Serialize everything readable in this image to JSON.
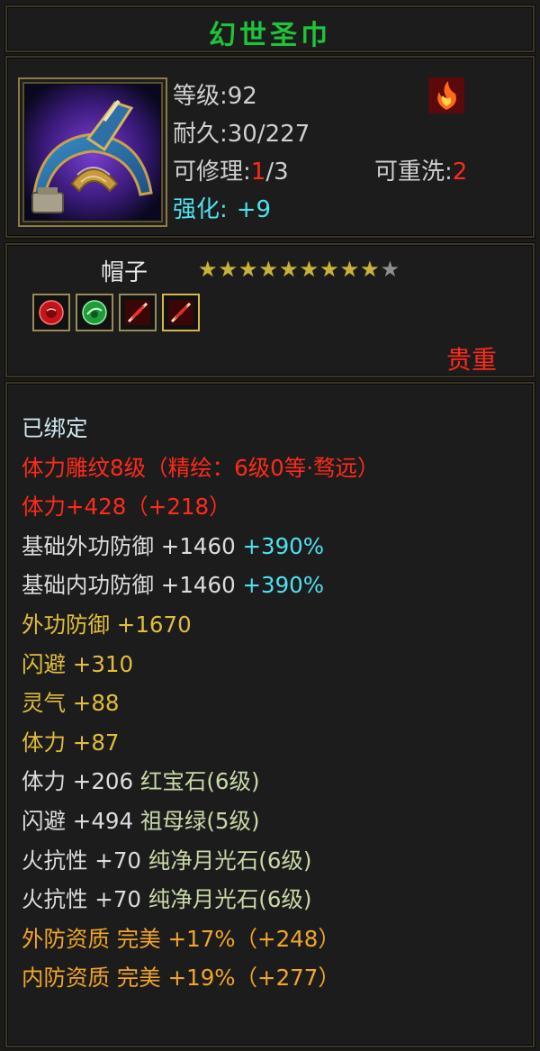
{
  "item": {
    "name": "幻世圣巾",
    "level": "等级:92",
    "durability": "耐久:30/227",
    "repair_label": "可修理:",
    "repair_value": "1",
    "repair_max": "/3",
    "reroll_label": "可重洗:",
    "reroll_value": "2",
    "enhance_label": "强化:",
    "enhance_value": "+9",
    "type": "帽子",
    "stars_total": 10,
    "stars_filled": 9,
    "rarity": "贵重",
    "gem_slots": [
      "red-gem-icon",
      "green-gem-icon",
      "red-fire-gem-icon",
      "gold-fire-gem-icon"
    ]
  },
  "stats": [
    {
      "parts": [
        {
          "t": "已绑定",
          "c": "c-bound"
        }
      ]
    },
    {
      "parts": [
        {
          "t": "体力雕纹8级（精绘：6级0等·骛远）",
          "c": "c-red"
        }
      ]
    },
    {
      "parts": [
        {
          "t": "体力+428（+218）",
          "c": "c-red"
        }
      ]
    },
    {
      "parts": [
        {
          "t": "基础外功防御 +1460 ",
          "c": "c-white"
        },
        {
          "t": "+390%",
          "c": "c-cyan"
        }
      ]
    },
    {
      "parts": [
        {
          "t": "基础内功防御 +1460 ",
          "c": "c-white"
        },
        {
          "t": "+390%",
          "c": "c-cyan"
        }
      ]
    },
    {
      "parts": [
        {
          "t": "外功防御 +1670",
          "c": "c-yellow"
        }
      ]
    },
    {
      "parts": [
        {
          "t": "闪避 +310",
          "c": "c-yellow"
        }
      ]
    },
    {
      "parts": [
        {
          "t": "灵气 +88",
          "c": "c-yellow"
        }
      ]
    },
    {
      "parts": [
        {
          "t": "体力 +87",
          "c": "c-yellow"
        }
      ]
    },
    {
      "parts": [
        {
          "t": "体力 +206 ",
          "c": "c-white"
        },
        {
          "t": "红宝石(6级)",
          "c": "c-green"
        }
      ]
    },
    {
      "parts": [
        {
          "t": "闪避 +494 ",
          "c": "c-white"
        },
        {
          "t": "祖母绿(5级)",
          "c": "c-green"
        }
      ]
    },
    {
      "parts": [
        {
          "t": "火抗性 +70 ",
          "c": "c-white"
        },
        {
          "t": "纯净月光石(6级)",
          "c": "c-green"
        }
      ]
    },
    {
      "parts": [
        {
          "t": "火抗性 +70 ",
          "c": "c-white"
        },
        {
          "t": "纯净月光石(6级)",
          "c": "c-green"
        }
      ]
    },
    {
      "parts": [
        {
          "t": "外防资质  完美 +17%（+248）",
          "c": "c-orange"
        }
      ]
    },
    {
      "parts": [
        {
          "t": "内防资质  完美 +19%（+277）",
          "c": "c-orange"
        }
      ]
    }
  ]
}
